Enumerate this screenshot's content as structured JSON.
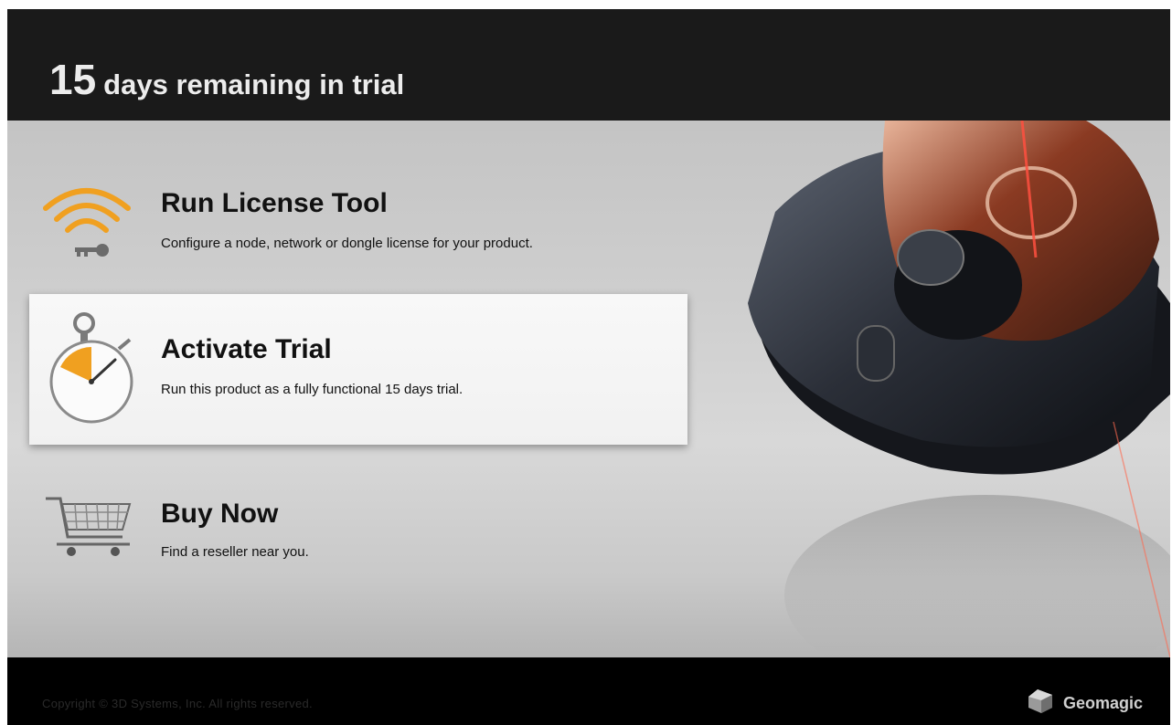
{
  "header": {
    "days_number": "15",
    "days_text": "days remaining in trial"
  },
  "options": [
    {
      "title": "Run License Tool",
      "description": "Configure a node, network or dongle license for your product.",
      "icon": "wifi-key-icon"
    },
    {
      "title": "Activate Trial",
      "description": "Run this product as a fully functional 15 days trial.",
      "icon": "stopwatch-icon"
    },
    {
      "title": "Buy Now",
      "description": "Find a reseller near you.",
      "icon": "shopping-cart-icon"
    }
  ],
  "footer": {
    "copyright": "Copyright © 3D Systems, Inc. All rights reserved.",
    "brand": "Geomagic"
  },
  "colors": {
    "accent_orange": "#f0a020",
    "header_bg": "#1a1a1a",
    "footer_bg": "#000000",
    "selected_panel": "#f4f4f4"
  }
}
